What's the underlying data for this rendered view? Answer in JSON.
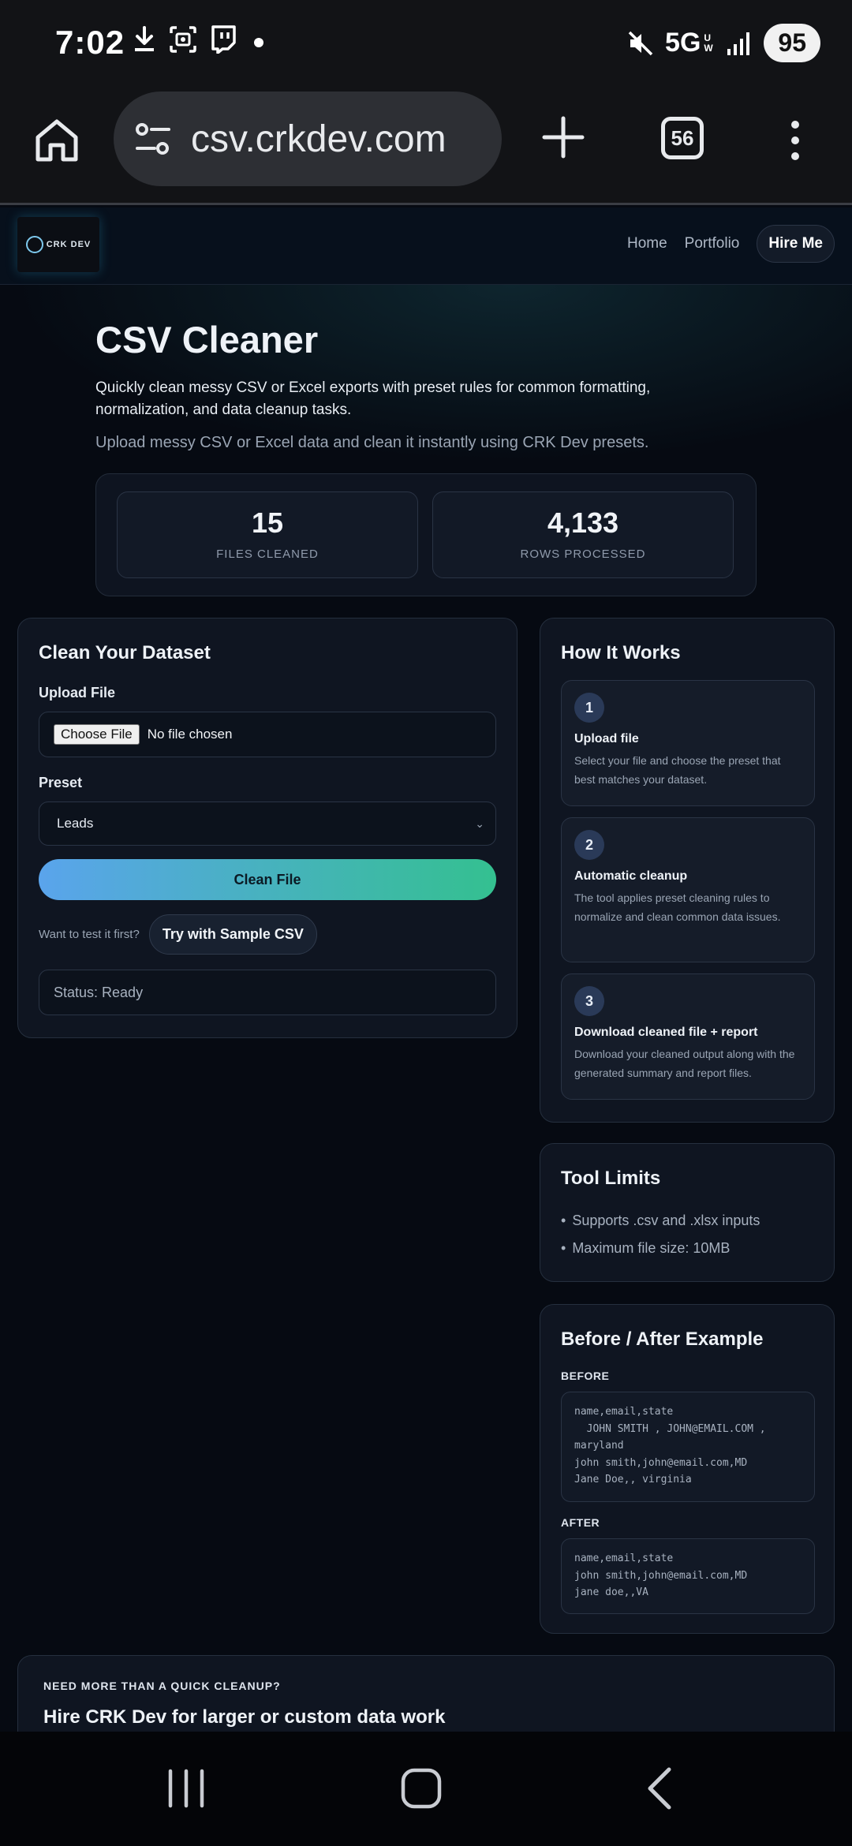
{
  "status_bar": {
    "time": "7:02",
    "network": "5G",
    "network_sub": "UW",
    "battery": "95"
  },
  "browser": {
    "url": "csv.crkdev.com",
    "tab_count": "56"
  },
  "site": {
    "logo_text": "CRK DEV",
    "nav": {
      "home": "Home",
      "portfolio": "Portfolio",
      "hire": "Hire Me"
    }
  },
  "hero": {
    "title": "CSV Cleaner",
    "description": "Quickly clean messy CSV or Excel exports with preset rules for common formatting, normalization, and data cleanup tasks.",
    "tagline": "Upload messy CSV or Excel data and clean it instantly using CRK Dev presets."
  },
  "stats": [
    {
      "value": "15",
      "label": "FILES CLEANED"
    },
    {
      "value": "4,133",
      "label": "ROWS PROCESSED"
    }
  ],
  "dataset": {
    "title": "Clean Your Dataset",
    "upload_label": "Upload File",
    "file_button": "Choose File",
    "file_status": "No file chosen",
    "preset_label": "Preset",
    "preset_value": "Leads",
    "clean_button": "Clean File",
    "sample_prompt": "Want to test it first?",
    "sample_button": "Try with Sample CSV",
    "status": "Status: Ready"
  },
  "how": {
    "title": "How It Works",
    "steps": [
      {
        "num": "1",
        "title": "Upload file",
        "desc": "Select your file and choose the preset that best matches your dataset."
      },
      {
        "num": "2",
        "title": "Automatic cleanup",
        "desc": "The tool applies preset cleaning rules to normalize and clean common data issues."
      },
      {
        "num": "3",
        "title": "Download cleaned file + report",
        "desc": "Download your cleaned output along with the generated summary and report files."
      }
    ]
  },
  "limits": {
    "title": "Tool Limits",
    "items": [
      "Supports .csv and .xlsx inputs",
      "Maximum file size: 10MB"
    ]
  },
  "before_after": {
    "title": "Before / After Example",
    "before_label": "BEFORE",
    "before_code": "name,email,state\n  JOHN SMITH , JOHN@EMAIL.COM , maryland\njohn smith,john@email.com,MD\nJane Doe,, virginia",
    "after_label": "AFTER",
    "after_code": "name,email,state\njohn smith,john@email.com,MD\njane doe,,VA"
  },
  "cta": {
    "eyebrow": "NEED MORE THAN A QUICK CLEANUP?",
    "headline": "Hire CRK Dev for larger or custom data work"
  },
  "colors": {
    "accent_start": "#5aa4ec",
    "accent_end": "#34c090",
    "background": "#060a12",
    "card": "#0f1521"
  }
}
